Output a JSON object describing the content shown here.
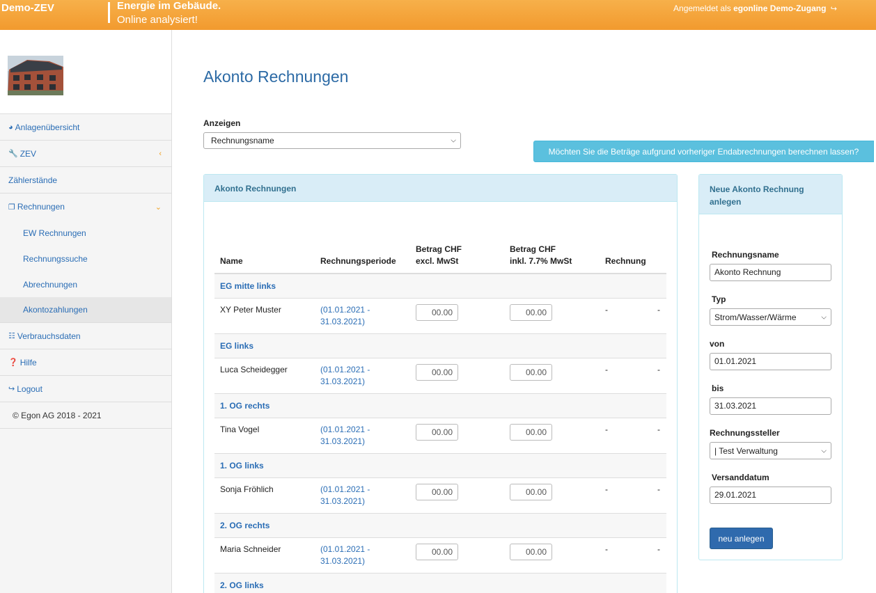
{
  "header": {
    "brand": "Demo-ZEV",
    "tagline1": "Energie im Gebäude.",
    "tagline2": "Online analysiert!",
    "login_prefix": "Angemeldet als",
    "login_user": "egonline Demo-Zugang",
    "logout_icon": "sign-out-icon"
  },
  "sidebar": {
    "items": [
      {
        "label": "Anlagenübersicht",
        "icon": "dashboard-icon"
      },
      {
        "label": "ZEV",
        "icon": "wrench-icon"
      },
      {
        "label": "Zählerstände"
      },
      {
        "label": "Rechnungen",
        "icon": "copy-icon"
      },
      {
        "label": "Verbrauchsdaten",
        "icon": "sitemap-icon"
      },
      {
        "label": "Hilfe",
        "icon": "question-circle-icon"
      },
      {
        "label": "Logout",
        "icon": "sign-out-icon"
      },
      {
        "label": "© Egon AG 2018 - 2021"
      }
    ],
    "subitems": [
      {
        "label": "EW Rechnungen"
      },
      {
        "label": "Rechnungssuche"
      },
      {
        "label": "Abrechnungen"
      },
      {
        "label": "Akontozahlungen",
        "active": true
      }
    ]
  },
  "main": {
    "title": "Akonto Rechnungen",
    "anzeigen_label": "Anzeigen",
    "anzeigen_value": "Rechnungsname",
    "calc_button": "Möchten Sie die Beträge aufgrund vorheriger Endabrechnungen berechnen lassen?"
  },
  "table": {
    "panel_title": "Akonto Rechnungen",
    "headers": {
      "name": "Name",
      "period": "Rechnungsperiode",
      "excl_line1": "Betrag CHF",
      "excl_line2": "excl. MwSt",
      "incl_line1": "Betrag CHF",
      "incl_line2": "inkl. 7.7% MwSt",
      "invoice": "Rechnung"
    },
    "groups": [
      {
        "label": "EG mitte links",
        "row": {
          "name": "XY Peter Muster",
          "period1": "(01.01.2021 -",
          "period2": "31.03.2021)",
          "excl": "00.00",
          "incl": "00.00",
          "invoice": "-",
          "extra": "-"
        }
      },
      {
        "label": "EG links",
        "row": {
          "name": "Luca Scheidegger",
          "period1": "(01.01.2021 -",
          "period2": "31.03.2021)",
          "excl": "00.00",
          "incl": "00.00",
          "invoice": "-",
          "extra": "-"
        }
      },
      {
        "label": "1. OG rechts",
        "row": {
          "name": "Tina Vogel",
          "period1": "(01.01.2021 -",
          "period2": "31.03.2021)",
          "excl": "00.00",
          "incl": "00.00",
          "invoice": "-",
          "extra": "-"
        }
      },
      {
        "label": "1. OG links",
        "row": {
          "name": "Sonja Fröhlich",
          "period1": "(01.01.2021 -",
          "period2": "31.03.2021)",
          "excl": "00.00",
          "incl": "00.00",
          "invoice": "-",
          "extra": "-"
        }
      },
      {
        "label": "2. OG rechts",
        "row": {
          "name": "Maria Schneider",
          "period1": "(01.01.2021 -",
          "period2": "31.03.2021)",
          "excl": "00.00",
          "incl": "00.00",
          "invoice": "-",
          "extra": "-"
        }
      },
      {
        "label": "2. OG links"
      }
    ]
  },
  "new_form": {
    "title_line1": "Neue Akonto Rechnung",
    "title_line2": "anlegen",
    "name_label": "Rechnungsname",
    "name_value": "Akonto Rechnung",
    "typ_label": "Typ",
    "typ_value": "Strom/Wasser/Wärme",
    "von_label": "von",
    "von_value": "01.01.2021",
    "bis_label": "bis",
    "bis_value": "31.03.2021",
    "steller_label": "Rechnungssteller",
    "steller_value": "| Test Verwaltung",
    "versand_label": "Versanddatum",
    "versand_value": "29.01.2021",
    "submit": "neu anlegen"
  }
}
